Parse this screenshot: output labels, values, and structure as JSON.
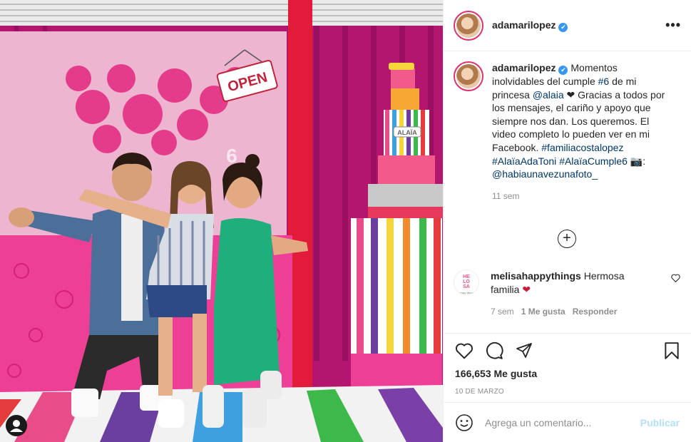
{
  "post": {
    "author": "adamarilopez",
    "verified_mark": "✔",
    "more_label": "•••",
    "photo_sign": "OPEN",
    "cake_label": "ALAÏA",
    "number_sign": "6",
    "caption_parts": [
      "Momentos inolvidables del cumple ",
      "#6",
      " de mi princesa ",
      "@alaia",
      " ❤ Gracias a todos por los mensajes, el cariño y apoyo que siempre nos dan. Los queremos. El video completo lo pueden ver en mi Facebook. ",
      "#familiacostalopez",
      " ",
      "#AlaïaAdaToni",
      " ",
      "#AlaïaCumple6",
      " 📷: ",
      "@habiaunavezunafoto_"
    ],
    "caption_age": "11 sem",
    "load_more": "+",
    "likes": "166,653 Me gusta",
    "date": "10 DE MARZO"
  },
  "comment": {
    "user": "melisahappythings",
    "text": " Hermosa familia ",
    "heart": "❤",
    "avatar_text": [
      "HE",
      "LO",
      "SA",
      "happy things"
    ],
    "age": "7 sem",
    "likes": "1 Me gusta",
    "reply": "Responder"
  },
  "composer": {
    "placeholder": "Agrega un comentario...",
    "publish": "Publicar"
  },
  "colors": {
    "brand_link": "#00376b",
    "muted": "#8e8e8e",
    "publish_disabled": "#b2dffc",
    "verified": "#3897f0",
    "heart_red": "#c81e3c"
  },
  "icons": [
    "more-icon",
    "heart-icon",
    "comment-icon",
    "share-icon",
    "bookmark-icon",
    "emoji-icon",
    "plus-circle-icon",
    "user-tag-icon"
  ]
}
